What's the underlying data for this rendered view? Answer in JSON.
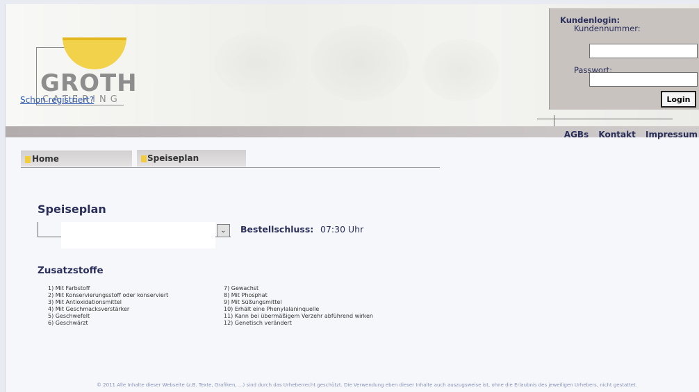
{
  "brand": {
    "logo_main": "GROTH",
    "logo_sub": "CATERING",
    "colors": {
      "logo_yellow": "#f2d24a",
      "nav_text": "#2a2f5a",
      "link": "#2d58b0"
    }
  },
  "login": {
    "title": "Kundenlogin:",
    "customer_number_label": "Kundennummer:",
    "customer_number_value": "",
    "password_label": "Passwort:",
    "password_value": "",
    "register_link": "Schon registriert?",
    "login_button": "Login"
  },
  "topnav": {
    "items": [
      "AGBs",
      "Kontakt",
      "Impressum"
    ]
  },
  "tabs": [
    {
      "label": "Home",
      "icon": "square-bullet-icon"
    },
    {
      "label": "Speiseplan",
      "icon": "square-bullet-icon"
    }
  ],
  "main": {
    "title": "Speiseplan",
    "week_select_value": "",
    "bestellschluss_label": "Bestellschluss:",
    "bestellschluss_value": "07:30 Uhr",
    "select_arrow_icon": "chevron-down-icon"
  },
  "zusatzstoffe": {
    "title": "Zusatzstoffe",
    "left": [
      "1) Mit Farbstoff",
      "2) Mit Konservierungsstoff oder konserviert",
      "3) Mit Antioxidationsmittel",
      "4) Mit Geschmacksverstärker",
      "5) Geschwefelt",
      "6) Geschwärzt"
    ],
    "right": [
      "7) Gewachst",
      "8) Mit Phosphat",
      "9) Mit Süßungsmittel",
      "10) Erhält eine Phenylalaninquelle",
      "11) Kann bei übermäßigem Verzehr abführend wirken",
      "12) Genetisch verändert"
    ]
  },
  "footer": {
    "text": "© 2011 Alle Inhalte dieser Webseite (z.B. Texte, Grafiken, ...) sind durch das Urheberrecht geschützt. Die Verwendung eben dieser Inhalte auch auszugsweise ist, ohne die Erlaubnis des jeweiligen Urhebers, nicht gestattet."
  }
}
